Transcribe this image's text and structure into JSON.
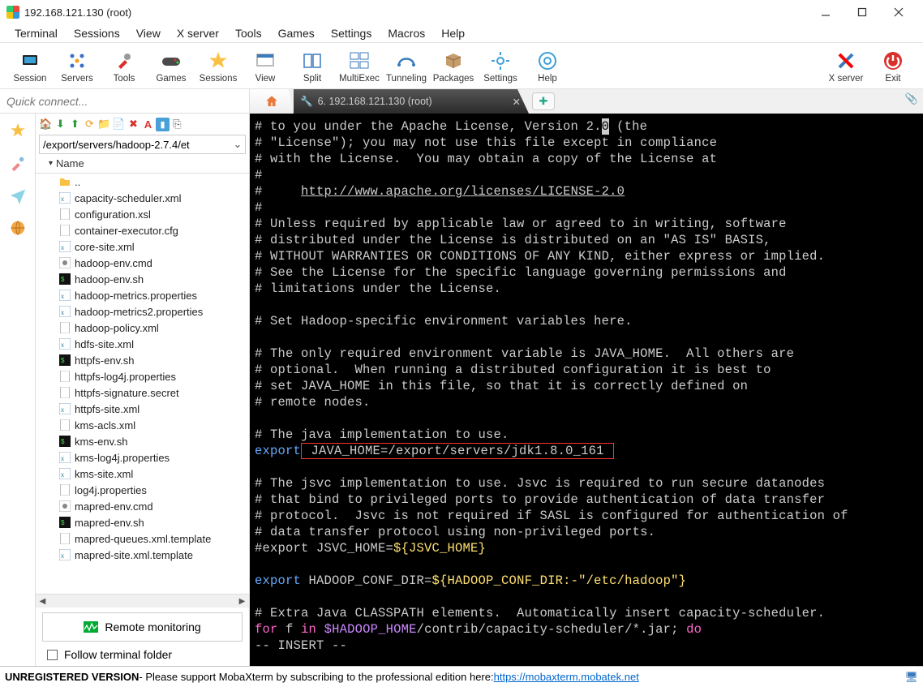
{
  "window": {
    "title": "192.168.121.130 (root)"
  },
  "menu": [
    "Terminal",
    "Sessions",
    "View",
    "X server",
    "Tools",
    "Games",
    "Settings",
    "Macros",
    "Help"
  ],
  "toolbar": [
    {
      "label": "Session",
      "icon": "session"
    },
    {
      "label": "Servers",
      "icon": "servers"
    },
    {
      "label": "Tools",
      "icon": "tools"
    },
    {
      "label": "Games",
      "icon": "games"
    },
    {
      "label": "Sessions",
      "icon": "star"
    },
    {
      "label": "View",
      "icon": "view"
    },
    {
      "label": "Split",
      "icon": "split"
    },
    {
      "label": "MultiExec",
      "icon": "multiexec"
    },
    {
      "label": "Tunneling",
      "icon": "tunnel"
    },
    {
      "label": "Packages",
      "icon": "packages"
    },
    {
      "label": "Settings",
      "icon": "settings"
    },
    {
      "label": "Help",
      "icon": "help"
    }
  ],
  "toolbar_right": [
    {
      "label": "X server",
      "icon": "xserver"
    },
    {
      "label": "Exit",
      "icon": "exit"
    }
  ],
  "quick_connect_placeholder": "Quick connect...",
  "side_icons": [
    "star",
    "brush",
    "plane",
    "globe"
  ],
  "browser_path": "/export/servers/hadoop-2.7.4/et",
  "tree_header": "Name",
  "parent_dir": "..",
  "files": [
    {
      "name": "capacity-scheduler.xml",
      "icon": "xml"
    },
    {
      "name": "configuration.xsl",
      "icon": "file"
    },
    {
      "name": "container-executor.cfg",
      "icon": "txt"
    },
    {
      "name": "core-site.xml",
      "icon": "xml"
    },
    {
      "name": "hadoop-env.cmd",
      "icon": "cmd"
    },
    {
      "name": "hadoop-env.sh",
      "icon": "sh"
    },
    {
      "name": "hadoop-metrics.properties",
      "icon": "xml"
    },
    {
      "name": "hadoop-metrics2.properties",
      "icon": "xml"
    },
    {
      "name": "hadoop-policy.xml",
      "icon": "txt"
    },
    {
      "name": "hdfs-site.xml",
      "icon": "xml"
    },
    {
      "name": "httpfs-env.sh",
      "icon": "sh"
    },
    {
      "name": "httpfs-log4j.properties",
      "icon": "txt"
    },
    {
      "name": "httpfs-signature.secret",
      "icon": "txt"
    },
    {
      "name": "httpfs-site.xml",
      "icon": "xml"
    },
    {
      "name": "kms-acls.xml",
      "icon": "txt"
    },
    {
      "name": "kms-env.sh",
      "icon": "sh"
    },
    {
      "name": "kms-log4j.properties",
      "icon": "xml"
    },
    {
      "name": "kms-site.xml",
      "icon": "xml"
    },
    {
      "name": "log4j.properties",
      "icon": "txt"
    },
    {
      "name": "mapred-env.cmd",
      "icon": "cmd"
    },
    {
      "name": "mapred-env.sh",
      "icon": "sh"
    },
    {
      "name": "mapred-queues.xml.template",
      "icon": "txt"
    },
    {
      "name": "mapred-site.xml.template",
      "icon": "xml"
    }
  ],
  "remote_monitoring": "Remote monitoring",
  "follow_terminal": "Follow terminal folder",
  "tab": {
    "label": "6. 192.168.121.130 (root)"
  },
  "terminal": {
    "l1": "# to you under the Apache License, Version 2.",
    "l1b": " (the",
    "l2": "# \"License\"); you may not use this file except in compliance",
    "l3": "# with the License.  You may obtain a copy of the License at",
    "l4": "#",
    "l5a": "#     ",
    "l5link": "http://www.apache.org/licenses/LICENSE-2.0",
    "l6": "#",
    "l7": "# Unless required by applicable law or agreed to in writing, software",
    "l8": "# distributed under the License is distributed on an \"AS IS\" BASIS,",
    "l9": "# WITHOUT WARRANTIES OR CONDITIONS OF ANY KIND, either express or implied.",
    "l10": "# See the License for the specific language governing permissions and",
    "l11": "# limitations under the License.",
    "l13": "# Set Hadoop-specific environment variables here.",
    "l15": "# The only required environment variable is JAVA_HOME.  All others are",
    "l16": "# optional.  When running a distributed configuration it is best to",
    "l17": "# set JAVA_HOME in this file, so that it is correctly defined on",
    "l18": "# remote nodes.",
    "l20": "# The java implementation to use.",
    "l21a": "export",
    "l21b": " JAVA_HOME=/export/servers/jdk1.8.0_161 ",
    "l23": "# The jsvc implementation to use. Jsvc is required to run secure datanodes",
    "l24": "# that bind to privileged ports to provide authentication of data transfer",
    "l25": "# protocol.  Jsvc is not required if SASL is configured for authentication of",
    "l26": "# data transfer protocol using non-privileged ports.",
    "l27a": "#export JSVC_HOME=",
    "l27b": "${JSVC_HOME}",
    "l29a": "export",
    "l29b": " HADOOP_CONF_DIR=",
    "l29c": "${HADOOP_CONF_DIR:-\"/etc/hadoop\"}",
    "l31": "# Extra Java CLASSPATH elements.  Automatically insert capacity-scheduler.",
    "l32a": "for",
    "l32b": " f ",
    "l32c": "in",
    "l32d": " ",
    "l32e": "$HADOOP_HOME",
    "l32f": "/contrib/capacity-scheduler/*.jar; ",
    "l32g": "do",
    "l33": "-- INSERT --"
  },
  "status": {
    "unreg": "UNREGISTERED VERSION",
    "text": "  -  Please support MobaXterm by subscribing to the professional edition here:  ",
    "link": "https://mobaxterm.mobatek.net"
  }
}
